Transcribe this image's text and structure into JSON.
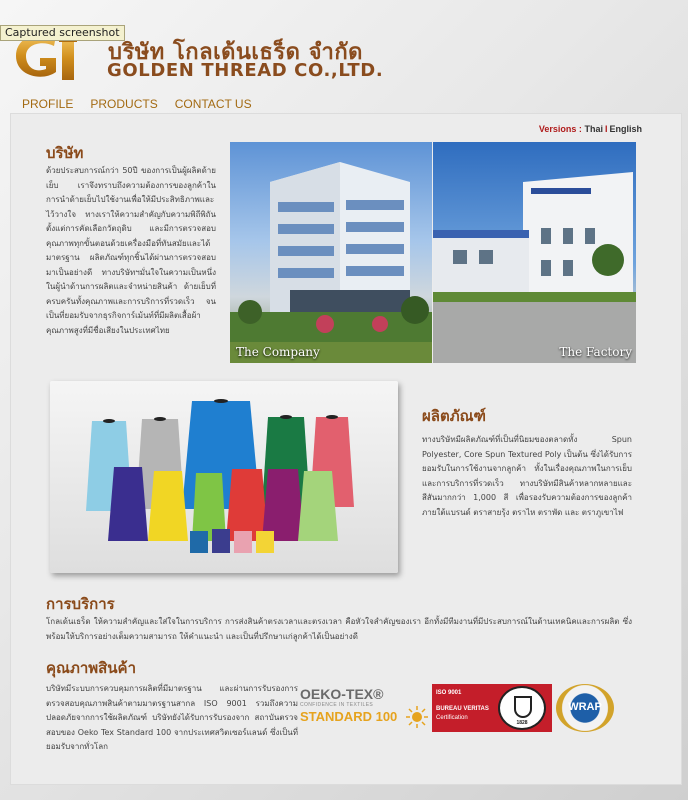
{
  "tooltip": "Captured screenshot",
  "header": {
    "company_thai": "บริษัท โกลเด้นเธร็ด จำกัด",
    "company_en": "GOLDEN THREAD CO.,LTD."
  },
  "nav": [
    {
      "label": "PROFILE"
    },
    {
      "label": "PRODUCTS"
    },
    {
      "label": "CONTACT US"
    }
  ],
  "versions": {
    "label": "Versions :",
    "thai": "Thai",
    "english": "English"
  },
  "company": {
    "title": "บริษัท",
    "text": "ด้วยประสบการณ์กว่า 50ปี ของการเป็นผู้ผลิตด้ายเย็บ เราจึงทราบถึงความต้องการของลูกค้าในการนำด้ายเย็บไปใช้งานเพื่อให้มีประสิทธิภาพและไว้วางใจ ทางเราให้ความสำคัญกับความพิถีพิถันตั้งแต่การคัดเลือกวัตถุดิบ และมีการตรวจสอบคุณภาพทุกขั้นตอนด้วยเครื่องมือที่ทันสมัยและได้มาตรฐาน ผลิตภัณฑ์ทุกชิ้นได้ผ่านการตรวจสอบมาเป็นอย่างดี ทางบริษัทฯมั่นใจในความเป็นหนึ่งในผู้นำด้านการผลิตและจำหน่ายสินค้า ด้ายเย็บที่ครบครันทั้งคุณภาพและการบริการที่รวดเร็ว จนเป็นที่ยอมรับจากธุรกิจการ์เม้นท์ที่มีผลิตเสื้อผ้าคุณภาพสูงที่มีชื่อเสียงในประเทศไทย",
    "caption_company": "The Company",
    "caption_factory": "The Factory"
  },
  "products": {
    "title": "ผลิตภัณฑ์",
    "text": "ทางบริษัทมีผลิตภัณฑ์ที่เป็นที่นิยมของตลาดทั้ง Spun Polyester, Core Spun Textured Poly เป็นต้น ซึ่งได้รับการยอมรับในการใช้งานจากลูกค้า ทั้งในเรื่องคุณภาพในการเย็บ และการบริการที่รวดเร็ว ทางบริษัทมีสินค้าหลากหลายและสีสันมากกว่า 1,000 สี เพื่อรองรับความต้องการของลูกค้า ภายใต้แบรนด์ ตราสายรุ้ง ตราไห ตราพัด และ ตราภูเขาไฟ"
  },
  "service": {
    "title": "การบริการ",
    "text": "โกลเด้นเธร็ด ให้ความสำคัญและใส่ใจในการบริการ การส่งสินค้าตรงเวลาและตรงเวลา คือหัวใจสำคัญของเรา อีกทั้งมีทีมงานที่มีประสบการณ์ในด้านเทคนิคและการผลิต ซึ่งพร้อมให้บริการอย่างเต็มความสามารถ ให้คำแนะนำ และเป็นที่ปรึกษาแก่ลูกค้าได้เป็นอย่างดี"
  },
  "quality": {
    "title": "คุณภาพสินค้า",
    "text": "บริษัทมีระบบการควบคุมการผลิตที่มีมาตรฐาน และผ่านการรับรองการตรวจสอบคุณภาพสินค้าตามมาตรฐานสากล ISO 9001 รวมถึงความปลอดภัยจากการใช้ผลิตภัณฑ์ บริษัทยังได้รับการรับรองจาก สถาบันตรวจสอบของ Oeko Tex Standard 100 จากประเทศสวิตเซอร์แลนด์ ซึ่งเป็นที่ยอมรับจากทั่วโลก"
  },
  "certs": {
    "oeko_title": "OEKO-TEX®",
    "oeko_sub": "CONFIDENCE IN TEXTILES",
    "oeko_std": "STANDARD 100",
    "iso": "ISO 9001",
    "bv": "BUREAU VERITAS",
    "bv_cert": "Certification",
    "bv_year": "1828",
    "wrap": "WRAP"
  },
  "colors": {
    "heading": "#8a4a1a",
    "nav": "#a36a12",
    "accent_red": "#b01c1c"
  }
}
